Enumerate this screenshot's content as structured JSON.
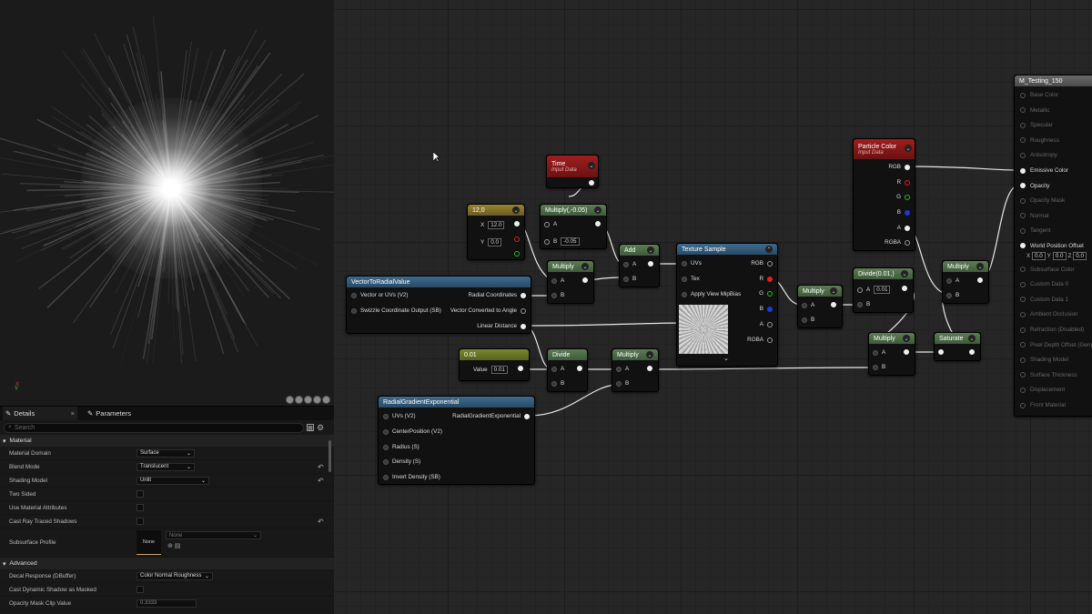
{
  "viewport": {
    "axis_x": "X",
    "axis_y": "Y"
  },
  "details": {
    "tabs": [
      {
        "label": "Details",
        "close": "×"
      },
      {
        "label": "Parameters"
      }
    ],
    "search_placeholder": "Search",
    "sections": {
      "material": "Material",
      "advanced": "Advanced"
    },
    "props": [
      {
        "label": "Material Domain",
        "value": "Surface",
        "type": "dropdown"
      },
      {
        "label": "Blend Mode",
        "value": "Translucent",
        "type": "dropdown"
      },
      {
        "label": "Shading Model",
        "value": "Unlit",
        "type": "dropdown"
      },
      {
        "label": "Two Sided",
        "type": "checkbox"
      },
      {
        "label": "Use Material Attributes",
        "type": "checkbox"
      },
      {
        "label": "Cast Ray Traced Shadows",
        "type": "checkbox"
      },
      {
        "label": "Subsurface Profile",
        "thumb": "None",
        "value": "None",
        "type": "asset"
      }
    ],
    "advanced_props": [
      {
        "label": "Decal Response (DBuffer)",
        "value": "Color Normal Roughness",
        "type": "dropdown"
      },
      {
        "label": "Cast Dynamic Shadow as Masked",
        "type": "checkbox"
      },
      {
        "label": "Opacity Mask Clip Value",
        "value": "0.3333",
        "type": "number"
      }
    ]
  },
  "graph": {
    "nodes": {
      "time": {
        "title": "Time",
        "subtitle": "Input Data"
      },
      "const2": {
        "title": "12,0",
        "x_label": "X",
        "x_value": "12.0",
        "y_label": "Y",
        "y_value": "0.0"
      },
      "multiply_neg": {
        "title": "Multiply(,-0.05)",
        "a": "A",
        "b": "B",
        "b_value": "-0.05"
      },
      "add": {
        "title": "Add",
        "a": "A",
        "b": "B"
      },
      "multiply1": {
        "title": "Multiply",
        "a": "A",
        "b": "B"
      },
      "vector_radial": {
        "title": "VectorToRadialValue",
        "in1": "Vector or UVs (V2)",
        "in2": "Swizzle Coordinate Output (SB)",
        "out1": "Radial Coordinates",
        "out2": "Vector Converted to Angle",
        "out3": "Linear Distance"
      },
      "const_001": {
        "title": "0.01",
        "value_label": "Value",
        "value": "0.01"
      },
      "divide": {
        "title": "Divide",
        "a": "A",
        "b": "B"
      },
      "multiply2": {
        "title": "Multiply",
        "a": "A",
        "b": "B"
      },
      "radial_gradient": {
        "title": "RadialGradientExponential",
        "in1": "UVs (V2)",
        "in2": "CenterPosition (V2)",
        "in3": "Radius (S)",
        "in4": "Density (S)",
        "in5": "Invert Density (SB)",
        "out1": "RadialGradientExponential"
      },
      "texture_sample": {
        "title": "Texture Sample",
        "uvs": "UVs",
        "tex": "Tex",
        "mip": "Apply View MipBias",
        "rgb": "RGB",
        "r": "R",
        "g": "G",
        "b": "B",
        "a": "A",
        "rgba": "RGBA"
      },
      "multiply3": {
        "title": "Multiply",
        "a": "A",
        "b": "B"
      },
      "particle_color": {
        "title": "Particle Color",
        "subtitle": "Input Data",
        "rgb": "RGB",
        "r": "R",
        "g": "G",
        "b": "B",
        "a": "A",
        "rgba": "RGBA"
      },
      "divide2": {
        "title": "Divide(0.01,)",
        "a": "A",
        "a_value": "0.01",
        "b": "B"
      },
      "multiply4": {
        "title": "Multiply",
        "a": "A",
        "b": "B"
      },
      "multiply5": {
        "title": "Multiply",
        "a": "A",
        "b": "B"
      },
      "saturate": {
        "title": "Saturate"
      }
    },
    "result": {
      "title": "M_Testing_150",
      "pins": [
        "Base Color",
        "Metallic",
        "Specular",
        "Roughness",
        "Anisotropy",
        "Emissive Color",
        "Opacity",
        "Opacity Mask",
        "Normal",
        "Tangent",
        "World Position Offset",
        "Subsurface Color",
        "Custom Data 0",
        "Custom Data 1",
        "Ambient Occlusion",
        "Refraction (Disabled)",
        "Pixel Depth Offset (Gen)",
        "Shading Model",
        "Surface Thickness",
        "Displacement",
        "Front Material"
      ],
      "wpo": {
        "x": "0.0",
        "y": "0.0",
        "z": "0.0",
        "x_label": "X",
        "y_label": "Y",
        "z_label": "Z"
      }
    }
  }
}
